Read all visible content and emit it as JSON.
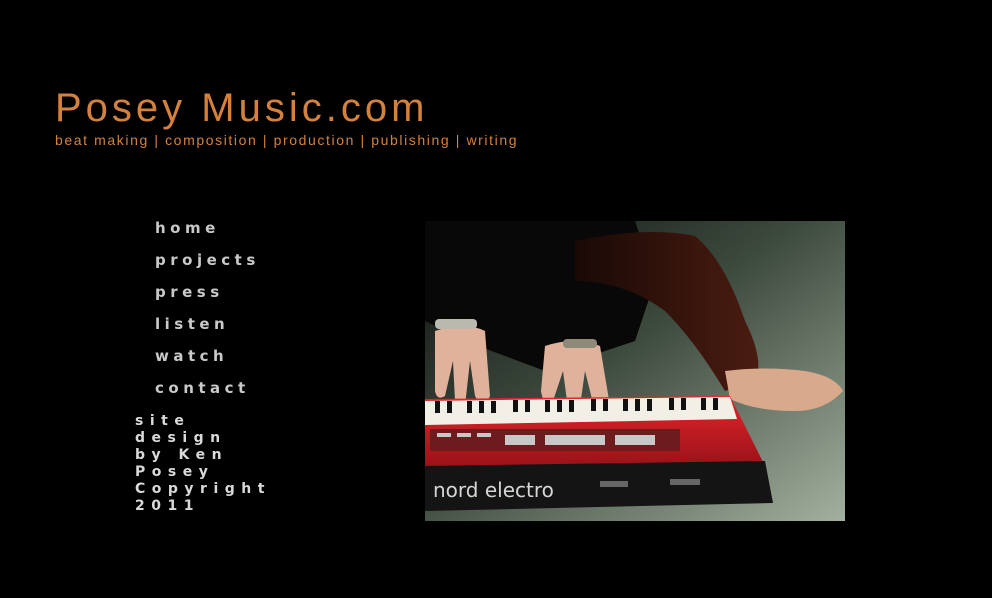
{
  "header": {
    "title": "Posey Music.com",
    "tagline": "beat making | composition | production | publishing | writing"
  },
  "nav": {
    "items": [
      {
        "label": "home"
      },
      {
        "label": "projects"
      },
      {
        "label": "press"
      },
      {
        "label": "listen"
      },
      {
        "label": "watch"
      },
      {
        "label": "contact"
      }
    ]
  },
  "credit": {
    "lines": [
      "site",
      "design",
      "by Ken",
      "Posey",
      "Copyright",
      "2011"
    ]
  },
  "photo": {
    "keyboard_brand": "nord electro"
  },
  "colors": {
    "background": "#000000",
    "accent": "#d5813e",
    "nav_text": "#c9c9c9",
    "keyboard_red": "#d31d1d"
  }
}
